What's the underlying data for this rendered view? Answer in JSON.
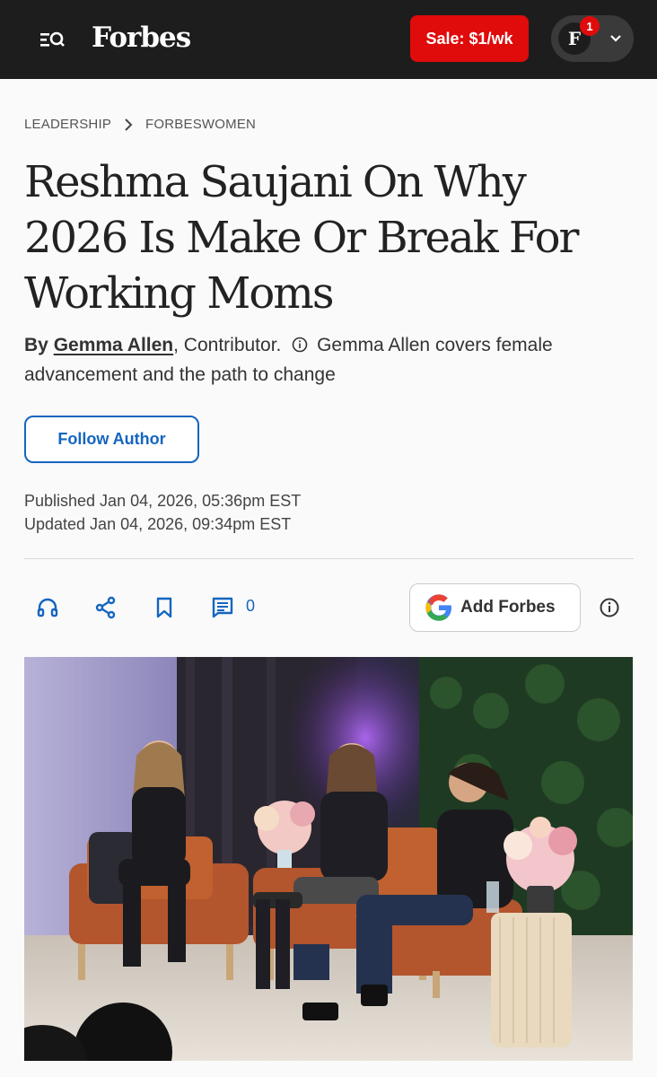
{
  "header": {
    "logo": "Forbes",
    "sale_label": "Sale: $1/wk",
    "avatar_letter": "F",
    "notification_count": "1"
  },
  "breadcrumb": {
    "section": "LEADERSHIP",
    "subsection": "FORBESWOMEN"
  },
  "article": {
    "title": "Reshma Saujani On Why 2026 Is Make Or Break For Working Moms",
    "by_label": "By",
    "author": "Gemma Allen",
    "role": ", Contributor.",
    "author_bio": "Gemma Allen covers female advancement and the path to change",
    "follow_label": "Follow Author",
    "published": "Published Jan 04, 2026, 05:36pm EST",
    "updated": "Updated Jan 04, 2026, 09:34pm EST"
  },
  "actions": {
    "comment_count": "0",
    "google_label": "Add Forbes"
  },
  "colors": {
    "accent_blue": "#1565c0",
    "sale_red": "#e00b0b",
    "header_bg": "#1d1d1d"
  },
  "icons": [
    "menu-search-icon",
    "chevron-down-icon",
    "chevron-right-icon",
    "info-icon",
    "headphones-icon",
    "share-icon",
    "bookmark-icon",
    "comment-icon",
    "google-icon"
  ]
}
